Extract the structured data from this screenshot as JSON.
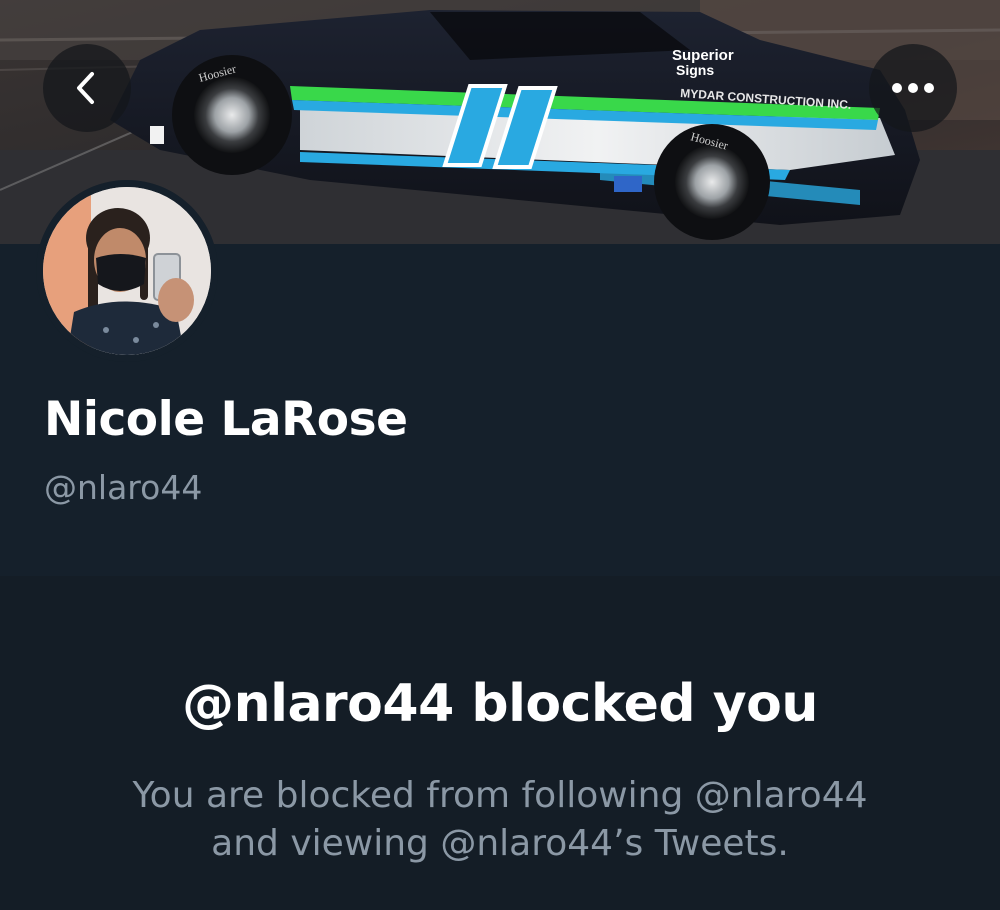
{
  "profile": {
    "display_name": "Nicole LaRose",
    "handle": "@nlaro44"
  },
  "banner": {
    "car_number": "11",
    "sponsor_lines": [
      "Superior",
      "Signs",
      "MYDAR CONSTRUCTION INC."
    ],
    "tire_brand": "Hoosier"
  },
  "nav": {
    "back_icon": "chevron-left-icon",
    "more_icon": "more-horizontal-icon"
  },
  "blocked": {
    "title": "@nlaro44 blocked you",
    "message_line1": "You are blocked from following @nlaro44",
    "message_line2": "and viewing @nlaro44’s Tweets."
  },
  "colors": {
    "background": "#15202b",
    "blocked_background": "#141d26",
    "primary_text": "#ffffff",
    "secondary_text": "#8b98a5",
    "car_accent_blue": "#29a9e1",
    "car_accent_green": "#39d84a"
  }
}
